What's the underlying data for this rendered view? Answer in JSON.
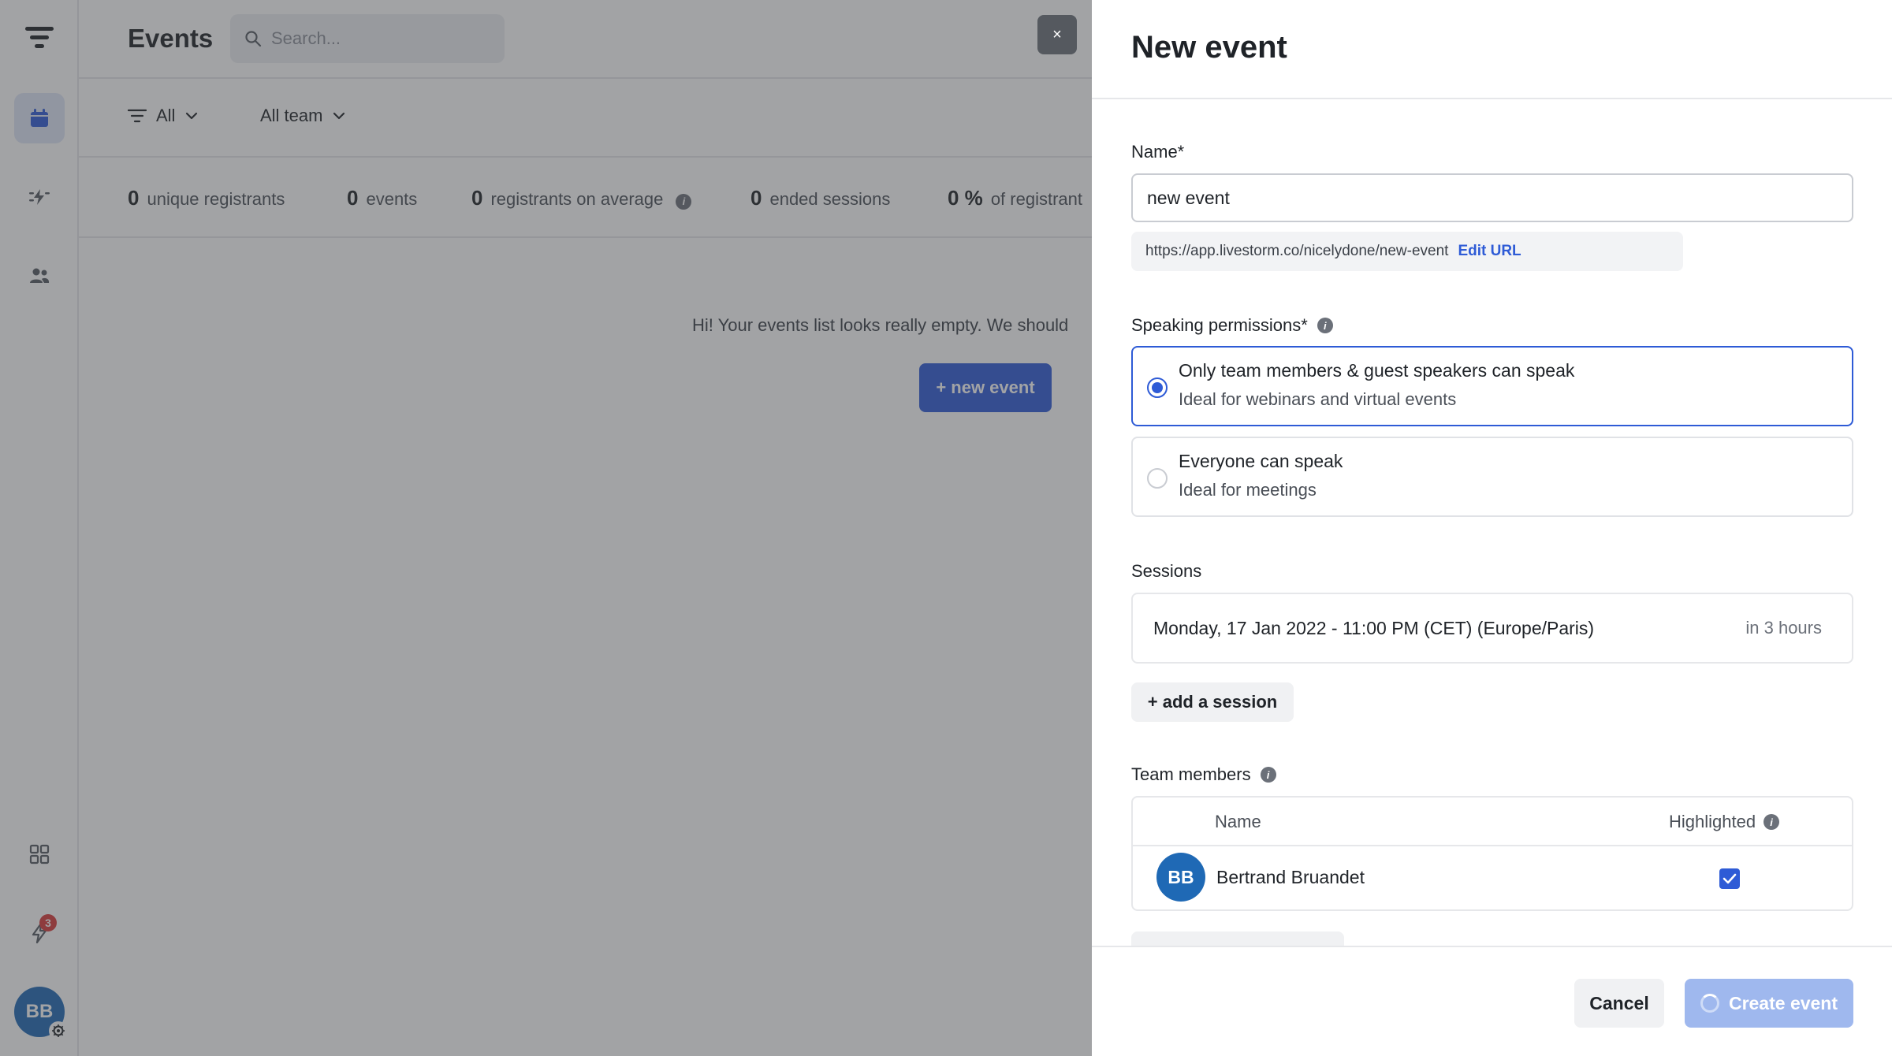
{
  "sidebar": {
    "items": [
      {
        "name": "logo-icon"
      },
      {
        "name": "calendar-icon",
        "active": true
      },
      {
        "name": "automation-icon"
      },
      {
        "name": "people-icon"
      },
      {
        "name": "apps-grid-icon"
      },
      {
        "name": "lightning-icon",
        "badge": "3"
      }
    ],
    "avatar_initials": "BB"
  },
  "header": {
    "title": "Events",
    "search_placeholder": "Search..."
  },
  "filters": {
    "type_label": "All",
    "team_label": "All team"
  },
  "stats": [
    {
      "value": "0",
      "label": "unique registrants"
    },
    {
      "value": "0",
      "label": "events"
    },
    {
      "value": "0",
      "label": "registrants on average"
    },
    {
      "value": "0",
      "label": "ended sessions"
    },
    {
      "value": "0 %",
      "label": "of registrant"
    }
  ],
  "empty_state": {
    "message": "Hi! Your events list looks really empty. We should",
    "button_label": "+ new event"
  },
  "close_label": "×",
  "drawer": {
    "title": "New event",
    "name_label": "Name*",
    "name_value": "new event",
    "url": "https://app.livestorm.co/nicelydone/new-event",
    "edit_url_label": "Edit URL",
    "permissions_label": "Speaking permissions*",
    "permissions": [
      {
        "title": "Only team members & guest speakers can speak",
        "desc": "Ideal for webinars and virtual events",
        "selected": true
      },
      {
        "title": "Everyone can speak",
        "desc": "Ideal for meetings",
        "selected": false
      }
    ],
    "sessions_label": "Sessions",
    "session": {
      "date": "Monday, 17 Jan 2022 - 11:00 PM (CET) (Europe/Paris)",
      "relative": "in 3 hours"
    },
    "add_session_label": "+ add a session",
    "team_members_label": "Team members",
    "table_headers": {
      "name": "Name",
      "highlighted": "Highlighted"
    },
    "members": [
      {
        "initials": "BB",
        "name": "Bertrand Bruandet",
        "highlighted": true
      }
    ],
    "cancel_label": "Cancel",
    "create_label": "Create event"
  },
  "colors": {
    "accent": "#2e5bd6",
    "avatar": "#1f69b5",
    "badge": "#d83a3a",
    "create_disabled": "#9fb8ee"
  }
}
